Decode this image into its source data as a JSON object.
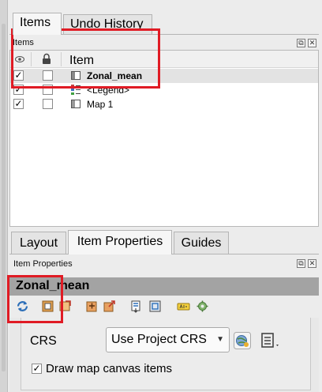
{
  "tabs_top": [
    "Items",
    "Undo History"
  ],
  "items_panel": {
    "title": "Items",
    "column_item": "Item",
    "rows": [
      {
        "name": "Zonal_mean",
        "visible": "✓",
        "locked": "",
        "selected": true
      },
      {
        "name": "<Legend>",
        "visible": "✓",
        "locked": ""
      },
      {
        "name": "Map 1",
        "visible": "✓",
        "locked": ""
      }
    ]
  },
  "tabs_bottom": [
    "Layout",
    "Item Properties",
    "Guides"
  ],
  "item_properties": {
    "dock_title": "Item Properties",
    "item_title": "Zonal_mean",
    "crs_label": "CRS",
    "crs_value": "Use Project CRS",
    "draw_map_canvas_items": "Draw map canvas items",
    "draw_checked": "✓"
  },
  "window_buttons": {
    "float": "⧉",
    "close": "✕"
  },
  "colors": {
    "highlight": "#e01b24",
    "title_bar": "#a3a3a3"
  }
}
